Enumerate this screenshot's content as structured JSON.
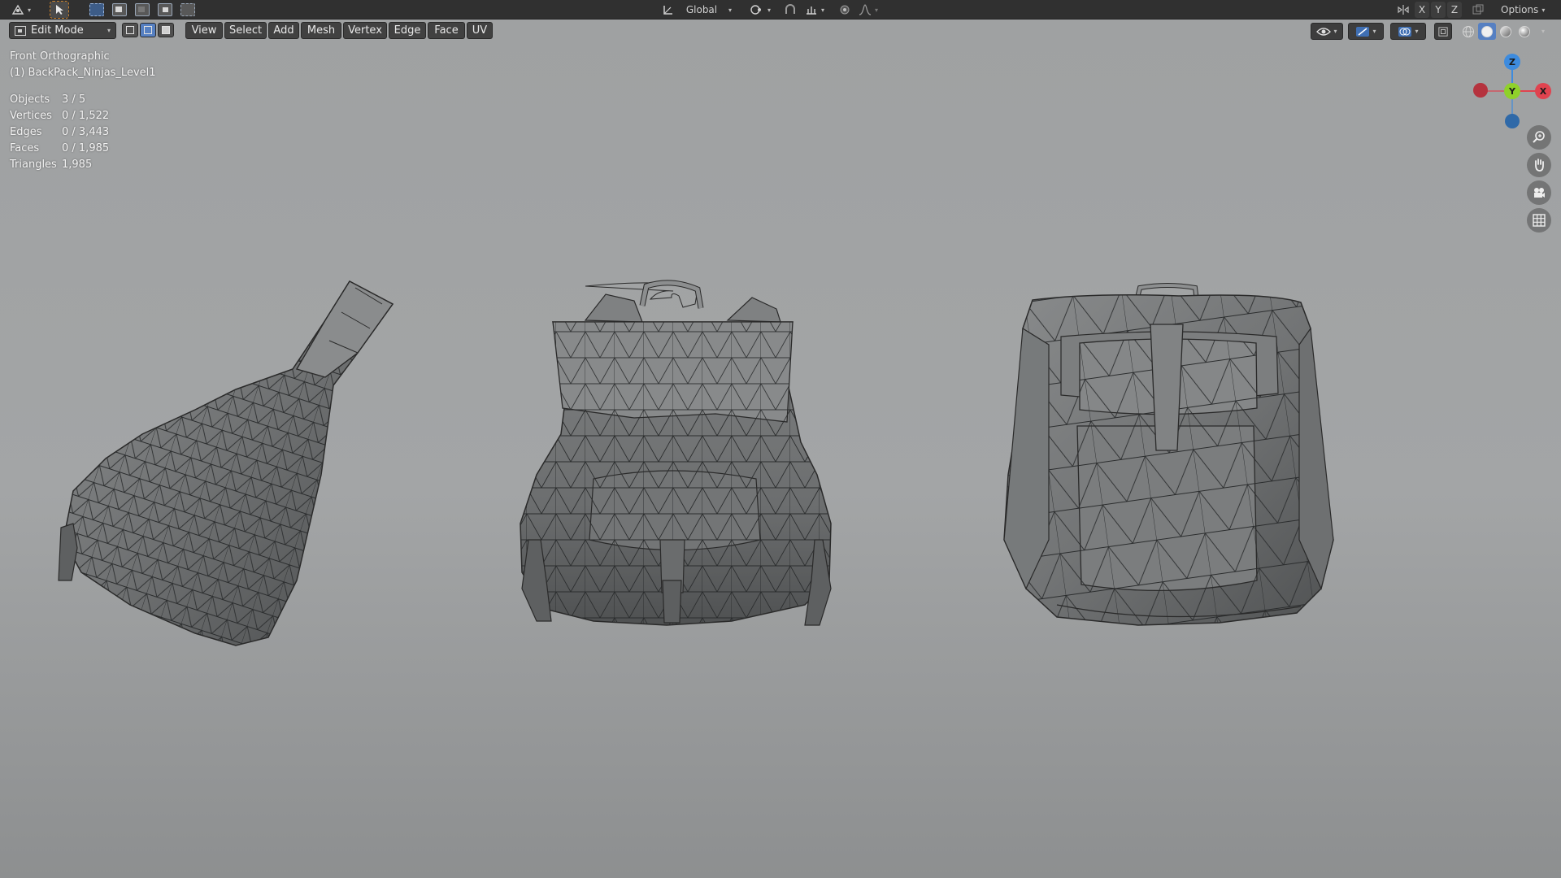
{
  "topbar": {
    "orientation_label": "Global",
    "axis_x": "X",
    "axis_y": "Y",
    "axis_z": "Z",
    "options_label": "Options"
  },
  "viewport_header": {
    "mode": "Edit Mode",
    "menus": [
      "View",
      "Select",
      "Add",
      "Mesh",
      "Vertex",
      "Edge",
      "Face",
      "UV"
    ]
  },
  "overlay": {
    "view_name": "Front Orthographic",
    "object_name": "(1) BackPack_Ninjas_Level1",
    "stats": [
      {
        "label": "Objects",
        "value": "3 / 5"
      },
      {
        "label": "Vertices",
        "value": "0 / 1,522"
      },
      {
        "label": "Edges",
        "value": "0 / 3,443"
      },
      {
        "label": "Faces",
        "value": "0 / 1,985"
      },
      {
        "label": "Triangles",
        "value": "1,985"
      }
    ]
  },
  "gizmo": {
    "z_label": "Z",
    "y_label": "Y",
    "x_label": "X",
    "colors": {
      "x": "#e0434f",
      "y": "#8fd12a",
      "z": "#3d8bde"
    }
  },
  "icons": {
    "topbar": [
      "editor-type-icon",
      "cursor-tool-icon",
      "select-box-icon",
      "transform-orientation-icon",
      "pivot-icon",
      "snap-icon",
      "proportional-edit-icon",
      "mirror-icon"
    ],
    "viewport": [
      "zoom-icon",
      "pan-hand-icon",
      "camera-icon",
      "grid-icon"
    ]
  }
}
